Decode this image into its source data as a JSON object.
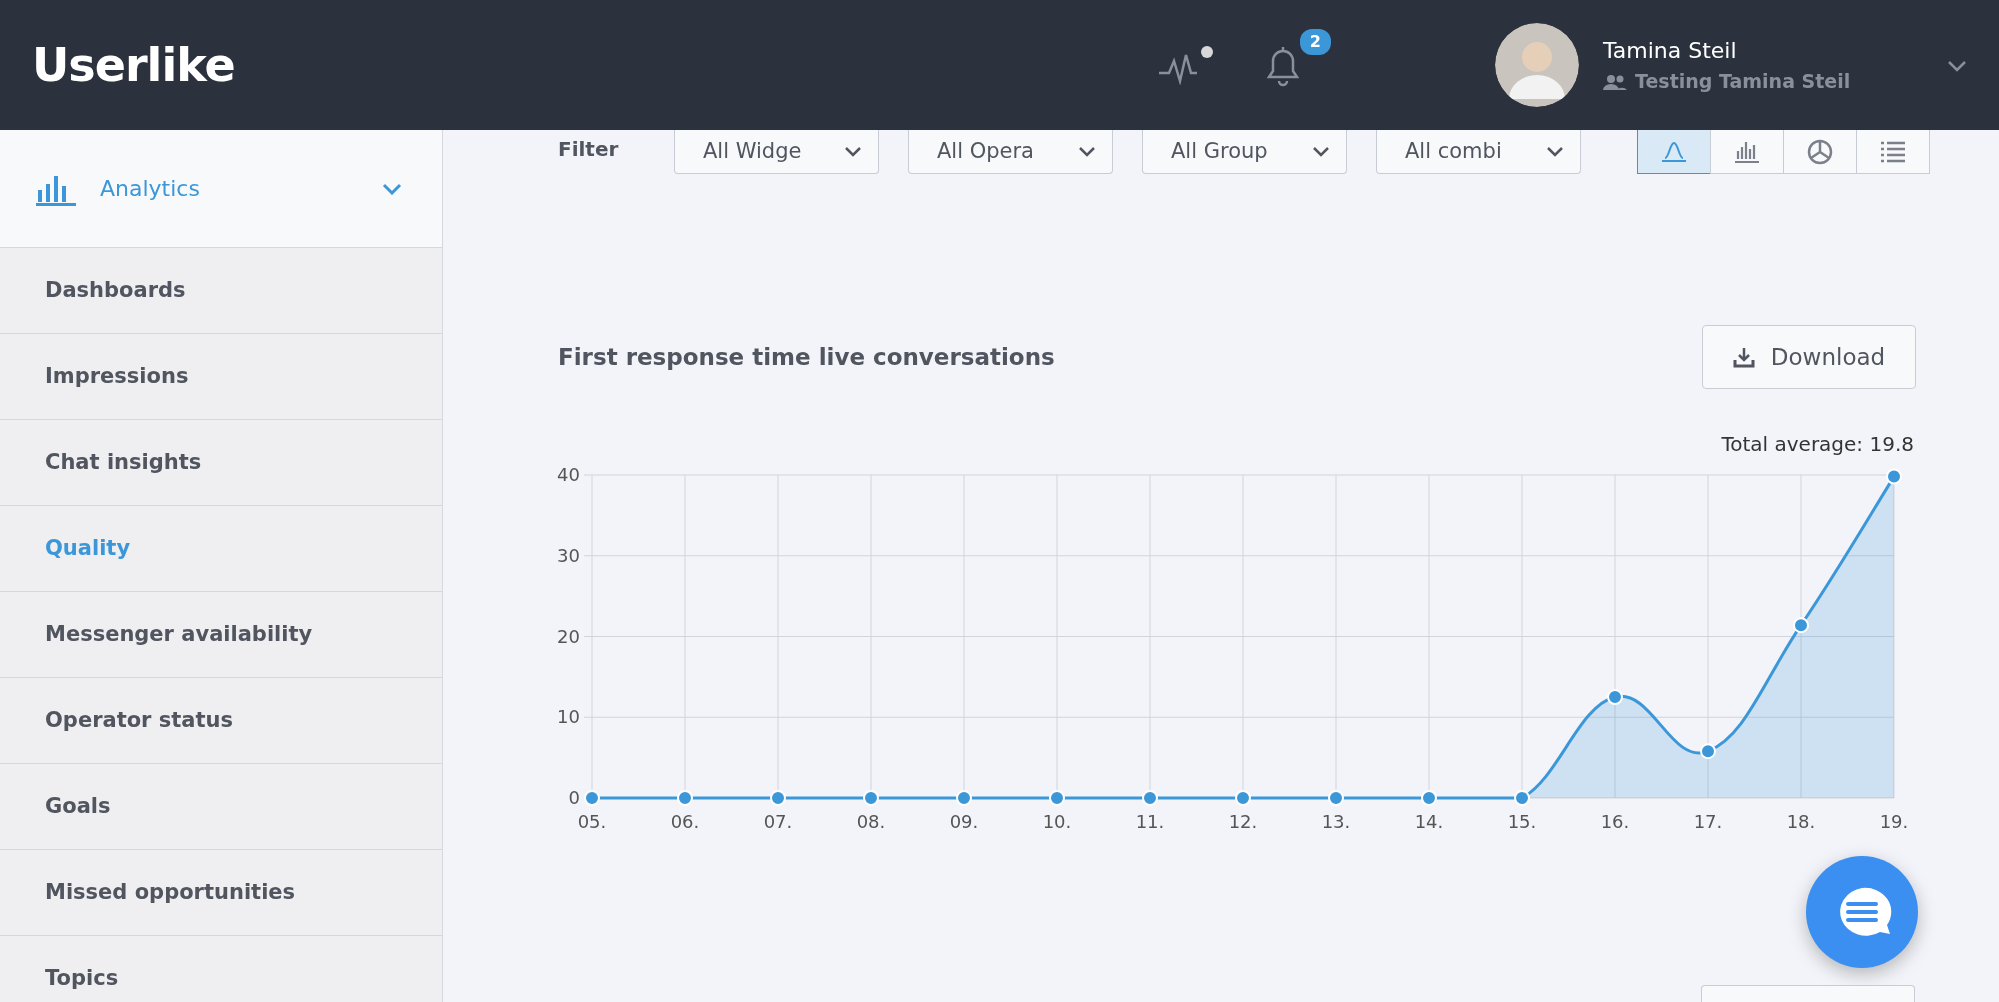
{
  "header": {
    "logo": "Userlike",
    "notification_count": "2",
    "user_name": "Tamina Steil",
    "user_subtitle": "Testing Tamina Steil"
  },
  "sidebar": {
    "section": {
      "label": "Analytics",
      "expanded": true
    },
    "items": [
      {
        "label": "Dashboards",
        "selected": false
      },
      {
        "label": "Impressions",
        "selected": false
      },
      {
        "label": "Chat insights",
        "selected": false
      },
      {
        "label": "Quality",
        "selected": true
      },
      {
        "label": "Messenger availability",
        "selected": false
      },
      {
        "label": "Operator status",
        "selected": false
      },
      {
        "label": "Goals",
        "selected": false
      },
      {
        "label": "Missed opportunities",
        "selected": false
      },
      {
        "label": "Topics",
        "selected": false
      }
    ]
  },
  "filter": {
    "label": "Filter",
    "dropdowns": [
      "All Widge",
      "All Opera",
      "All Group",
      "All combi"
    ],
    "views": [
      {
        "kind": "line",
        "selected": true
      },
      {
        "kind": "bar",
        "selected": false
      },
      {
        "kind": "pie",
        "selected": false
      },
      {
        "kind": "list",
        "selected": false
      }
    ]
  },
  "report": {
    "title": "First response time live conversations",
    "download_label": "Download",
    "total": "Total average: 19.8",
    "chart_data": {
      "type": "area",
      "categories": [
        "05.",
        "06.",
        "07.",
        "08.",
        "09.",
        "10.",
        "11.",
        "12.",
        "13.",
        "14.",
        "15.",
        "16.",
        "17.",
        "18.",
        "19."
      ],
      "grid": true,
      "series": [
        {
          "color": "#3b97d8",
          "values": [
            0,
            0,
            0,
            0,
            0,
            0,
            0,
            0,
            0,
            0,
            0,
            12.5,
            5.8,
            21.4,
            39.8
          ]
        }
      ],
      "ylim": [
        0,
        40
      ],
      "yticks": [
        0,
        10,
        20,
        30,
        40
      ]
    }
  }
}
